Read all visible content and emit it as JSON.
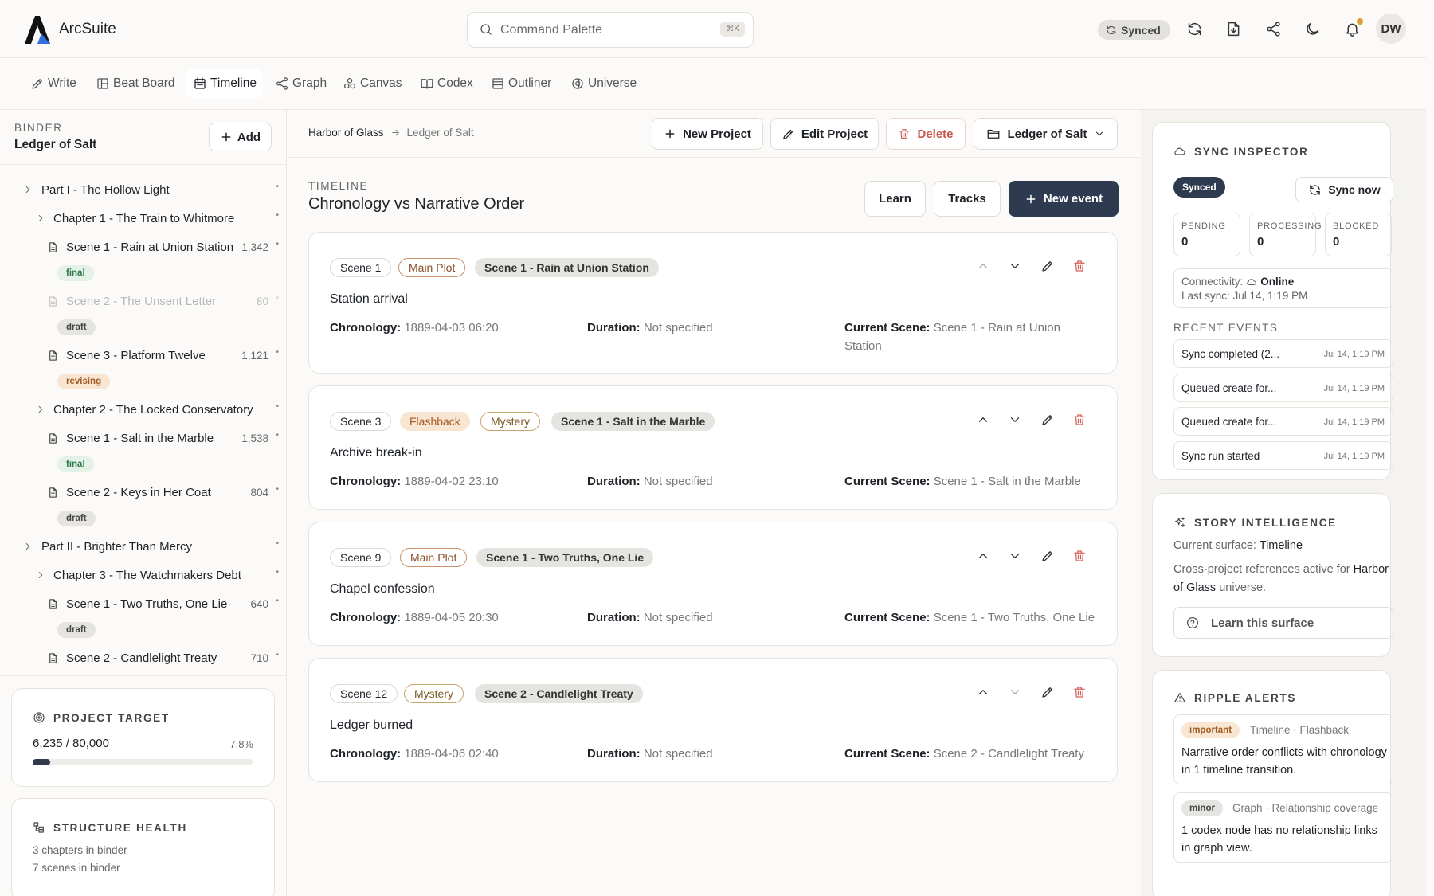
{
  "app": {
    "name": "ArcSuite",
    "user_initials": "DW",
    "sync_status": "Synced"
  },
  "search": {
    "placeholder": "Command Palette",
    "shortcut": "⌘K"
  },
  "header_icons": [
    "refresh-icon",
    "export-icon",
    "share-icon",
    "moon-icon",
    "bell-icon"
  ],
  "tabs": [
    {
      "label": "Write",
      "icon": "pencil-icon",
      "active": false
    },
    {
      "label": "Beat Board",
      "icon": "board-icon",
      "active": false
    },
    {
      "label": "Timeline",
      "icon": "calendar-icon",
      "active": true
    },
    {
      "label": "Graph",
      "icon": "graph-icon",
      "active": false
    },
    {
      "label": "Canvas",
      "icon": "canvas-icon",
      "active": false
    },
    {
      "label": "Codex",
      "icon": "book-icon",
      "active": false
    },
    {
      "label": "Outliner",
      "icon": "list-icon",
      "active": false
    },
    {
      "label": "Universe",
      "icon": "globe-icon",
      "active": false
    }
  ],
  "binder": {
    "label": "BINDER",
    "title": "Ledger of Salt",
    "add_label": "Add",
    "tree": [
      {
        "type": "part",
        "label": "Part I - The Hollow Light"
      },
      {
        "type": "chapter",
        "label": "Chapter 1 - The Train to Whitmore"
      },
      {
        "type": "scene",
        "label": "Scene 1 - Rain at Union Station",
        "count": "1,342",
        "status": "final"
      },
      {
        "type": "scene",
        "label": "Scene 2 - The Unsent Letter",
        "count": "80",
        "status": "draft",
        "faded": true
      },
      {
        "type": "scene",
        "label": "Scene 3 - Platform Twelve",
        "count": "1,121",
        "status": "revising"
      },
      {
        "type": "chapter",
        "label": "Chapter 2 - The Locked Conservatory"
      },
      {
        "type": "scene",
        "label": "Scene 1 - Salt in the Marble",
        "count": "1,538",
        "status": "final"
      },
      {
        "type": "scene",
        "label": "Scene 2 - Keys in Her Coat",
        "count": "804",
        "status": "draft"
      },
      {
        "type": "part",
        "label": "Part II - Brighter Than Mercy"
      },
      {
        "type": "chapter",
        "label": "Chapter 3 - The Watchmakers Debt"
      },
      {
        "type": "scene",
        "label": "Scene 1 - Two Truths, One Lie",
        "count": "640",
        "status": "draft"
      },
      {
        "type": "scene",
        "label": "Scene 2 - Candlelight Treaty",
        "count": "710"
      }
    ]
  },
  "project_target": {
    "heading": "PROJECT TARGET",
    "progress": "6,235 / 80,000",
    "percent": "7.8%",
    "fraction": 0.078
  },
  "structure_health": {
    "heading": "STRUCTURE HEALTH",
    "chapters": "3 chapters in binder",
    "scenes": "7 scenes in binder"
  },
  "breadcrumb": {
    "root": "Harbor of Glass",
    "current": "Ledger of Salt"
  },
  "toolbar": {
    "new_project": "New Project",
    "edit_project": "Edit Project",
    "delete": "Delete",
    "project_select": "Ledger of Salt"
  },
  "timeline": {
    "label": "TIMELINE",
    "title": "Chronology vs Narrative Order",
    "learn": "Learn",
    "tracks": "Tracks",
    "new_event": "New event",
    "field_labels": {
      "chronology": "Chronology:",
      "duration": "Duration:",
      "current_scene": "Current Scene:"
    },
    "events": [
      {
        "scene": "Scene 1",
        "tags": [
          {
            "label": "Main Plot",
            "kind": "plot"
          }
        ],
        "current_scene_chip": "Scene 1 - Rain at Union Station",
        "title": "Station arrival",
        "chronology": "1889-04-03 06:20",
        "duration": "Not specified",
        "current_scene": "Scene 1 - Rain at Union Station",
        "up_disabled": true,
        "down_disabled": false
      },
      {
        "scene": "Scene 3",
        "tags": [
          {
            "label": "Flashback",
            "kind": "flash"
          },
          {
            "label": "Mystery",
            "kind": "myst"
          }
        ],
        "current_scene_chip": "Scene 1 - Salt in the Marble",
        "title": "Archive break-in",
        "chronology": "1889-04-02 23:10",
        "duration": "Not specified",
        "current_scene": "Scene 1 - Salt in the Marble",
        "up_disabled": false,
        "down_disabled": false
      },
      {
        "scene": "Scene 9",
        "tags": [
          {
            "label": "Main Plot",
            "kind": "plot"
          }
        ],
        "current_scene_chip": "Scene 1 - Two Truths, One Lie",
        "title": "Chapel confession",
        "chronology": "1889-04-05 20:30",
        "duration": "Not specified",
        "current_scene": "Scene 1 - Two Truths, One Lie",
        "up_disabled": false,
        "down_disabled": false
      },
      {
        "scene": "Scene 12",
        "tags": [
          {
            "label": "Mystery",
            "kind": "myst"
          }
        ],
        "current_scene_chip": "Scene 2 - Candlelight Treaty",
        "title": "Ledger burned",
        "chronology": "1889-04-06 02:40",
        "duration": "Not specified",
        "current_scene": "Scene 2 - Candlelight Treaty",
        "up_disabled": false,
        "down_disabled": true
      }
    ]
  },
  "sync_inspector": {
    "heading": "SYNC INSPECTOR",
    "status": "Synced",
    "sync_now": "Sync now",
    "stats": [
      {
        "label": "PENDING",
        "value": "0"
      },
      {
        "label": "PROCESSING",
        "value": "0"
      },
      {
        "label": "BLOCKED",
        "value": "0"
      }
    ],
    "connectivity_label": "Connectivity:",
    "connectivity_value": "Online",
    "last_sync": "Last sync: Jul 14, 1:19 PM",
    "recent_label": "RECENT EVENTS",
    "recent": [
      {
        "text": "Sync completed (2...",
        "time": "Jul 14, 1:19 PM"
      },
      {
        "text": "Queued create for...",
        "time": "Jul 14, 1:19 PM"
      },
      {
        "text": "Queued create for...",
        "time": "Jul 14, 1:19 PM"
      },
      {
        "text": "Sync run started",
        "time": "Jul 14, 1:19 PM"
      }
    ]
  },
  "story_intelligence": {
    "heading": "STORY INTELLIGENCE",
    "surface_label": "Current surface:",
    "surface_value": "Timeline",
    "refs_line1": "Cross-project references active for",
    "refs_universe": "Harbor of Glass",
    "refs_line2": "universe.",
    "learn_button": "Learn this surface"
  },
  "ripple_alerts": {
    "heading": "RIPPLE ALERTS",
    "items": [
      {
        "severity": "important",
        "category": "Timeline · Flashback",
        "message": "Narrative order conflicts with chronology in 1 timeline transition."
      },
      {
        "severity": "minor",
        "category": "Graph · Relationship coverage",
        "message": "1 codex node has no relationship links in graph view."
      }
    ]
  }
}
